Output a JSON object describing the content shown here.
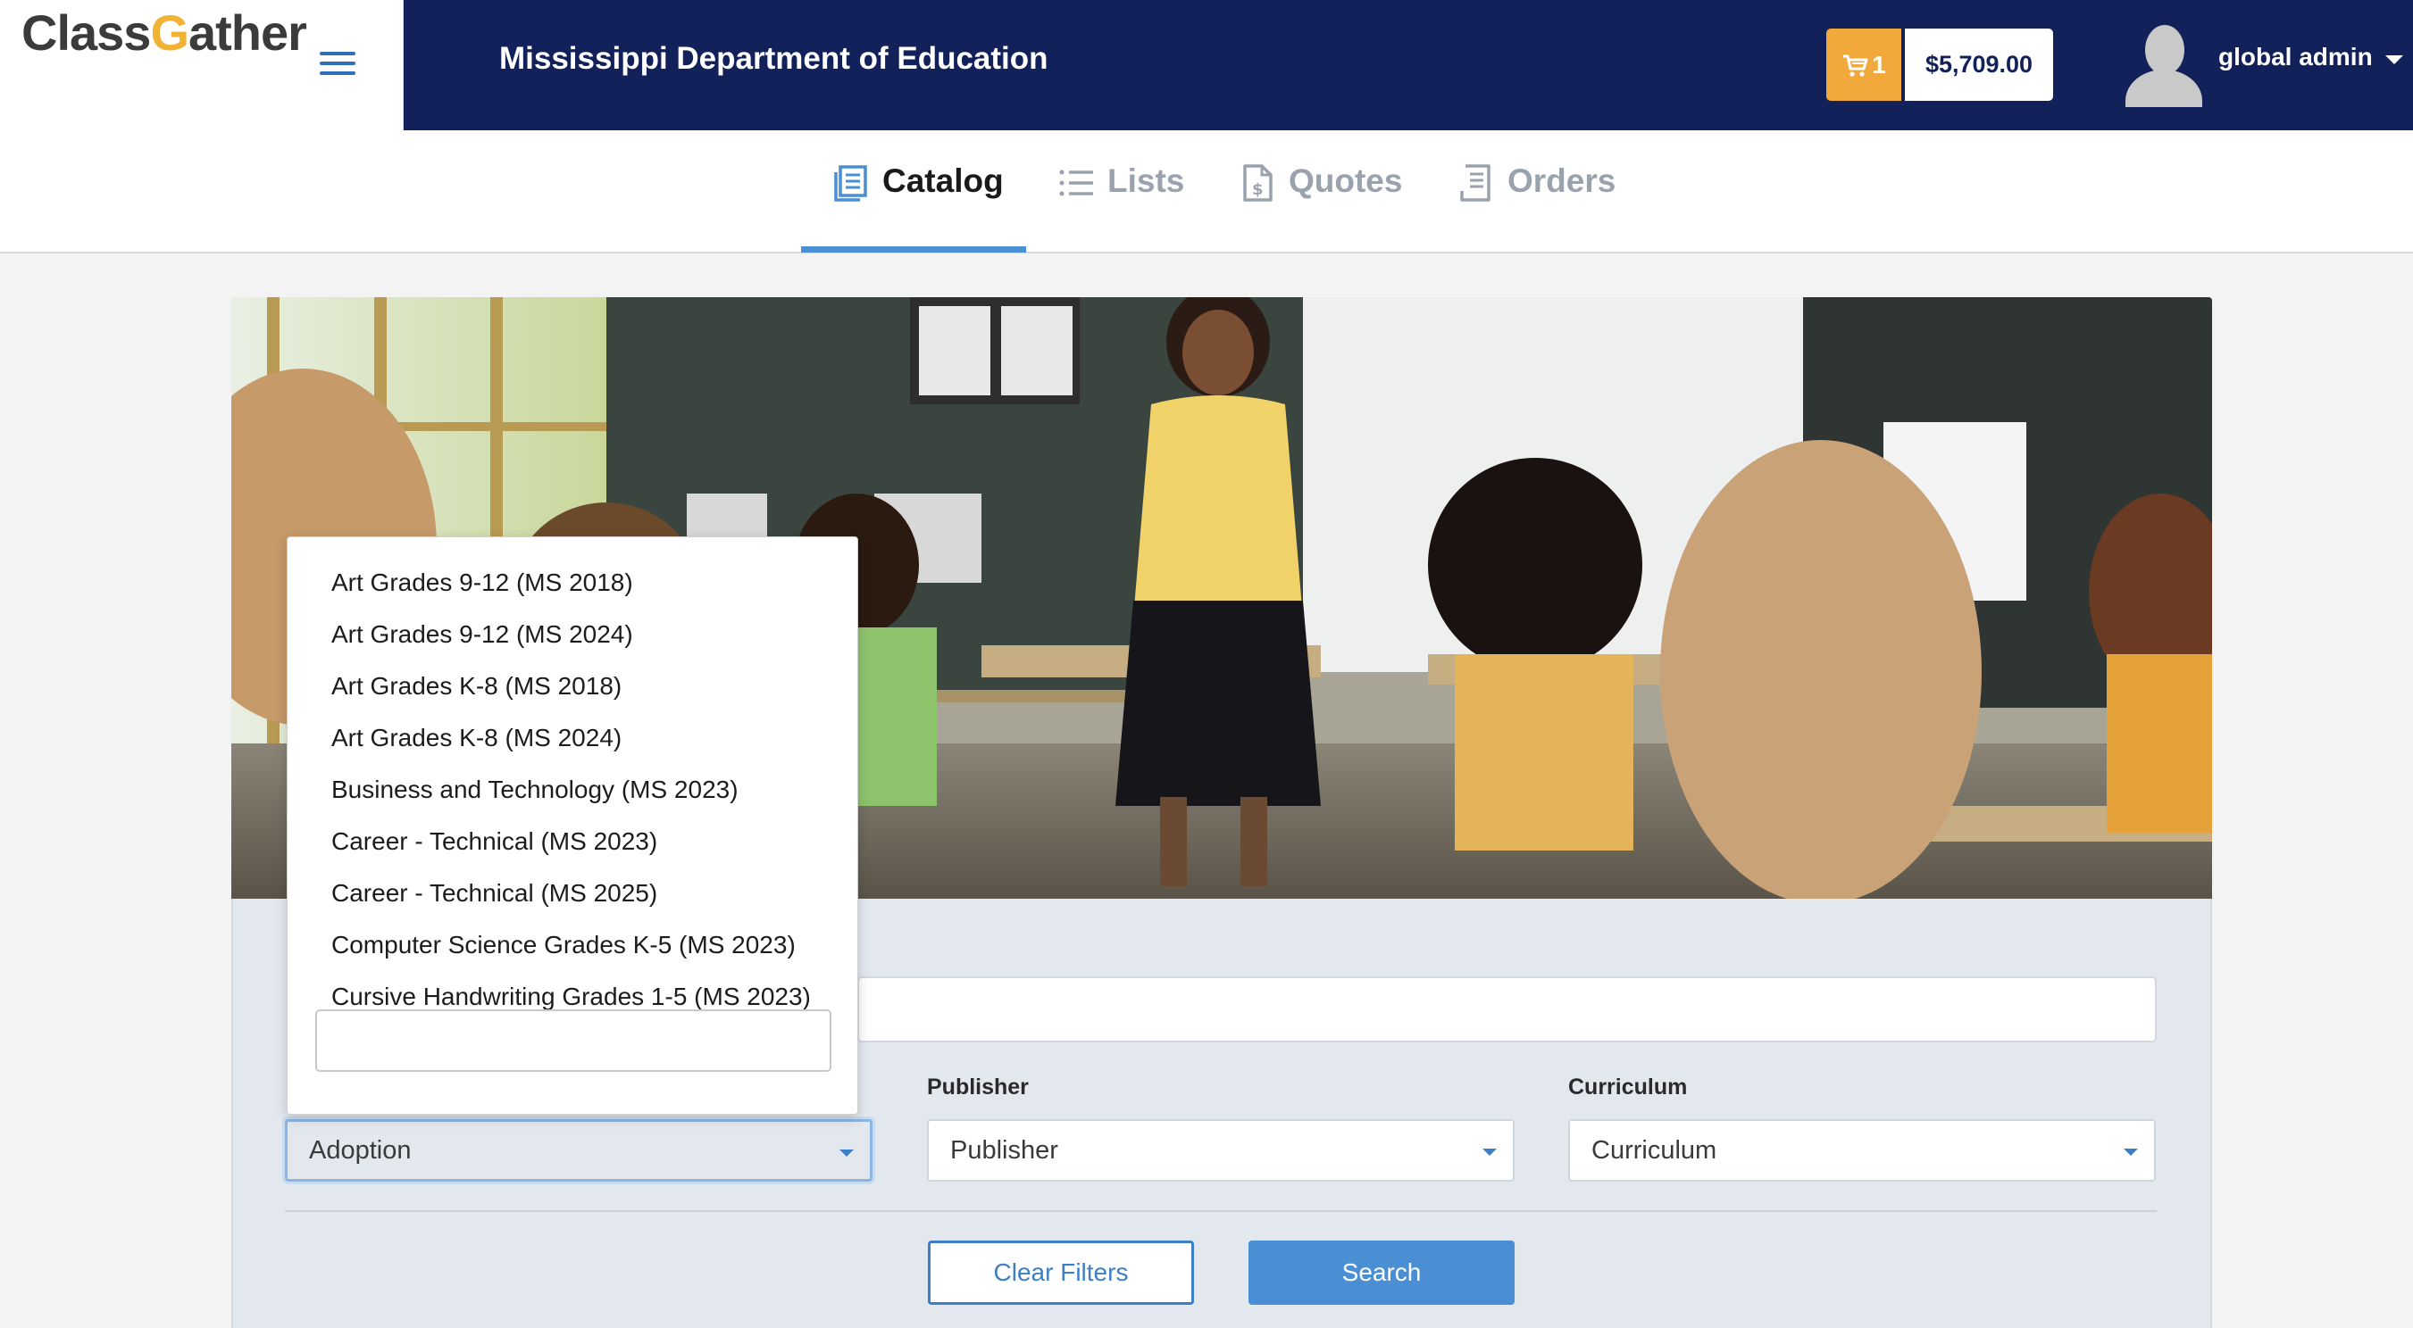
{
  "brand": {
    "logo_text_left": "Class",
    "logo_text_right": "ather",
    "logo_letter": "G",
    "org_title": "Mississippi Department of Education",
    "colors": {
      "navy": "#13215a",
      "accent": "#4a8ed4",
      "cart": "#f2a93b",
      "logo_gold": "#f2b233"
    }
  },
  "header": {
    "menu_icon": "hamburger-menu-icon",
    "cart_icon": "shopping-cart-icon",
    "cart_count": "1",
    "cart_total": "$5,709.00",
    "user_name": "global admin",
    "user_menu_icon": "chevron-down-icon"
  },
  "tabs": [
    {
      "label": "Catalog",
      "icon": "catalog-icon",
      "active": true
    },
    {
      "label": "Lists",
      "icon": "list-icon",
      "active": false
    },
    {
      "label": "Quotes",
      "icon": "quote-document-icon",
      "active": false
    },
    {
      "label": "Orders",
      "icon": "receipt-icon",
      "active": false
    }
  ],
  "filters": {
    "adoption": {
      "value": "Adoption",
      "open": true
    },
    "publisher": {
      "label": "Publisher",
      "value": "Publisher"
    },
    "curriculum": {
      "label": "Curriculum",
      "value": "Curriculum"
    },
    "keyword_value": "",
    "dropdown_search_value": "",
    "clear_label": "Clear Filters",
    "search_label": "Search"
  },
  "adoption_options": [
    "Art Grades 9-12 (MS 2018)",
    "Art Grades 9-12 (MS 2024)",
    "Art Grades K-8 (MS 2018)",
    "Art Grades K-8 (MS 2024)",
    "Business and Technology (MS 2023)",
    "Career - Technical (MS 2023)",
    "Career - Technical (MS 2025)",
    "Computer Science Grades K-5 (MS 2023)",
    "Cursive Handwriting Grades 1-5 (MS 2023)"
  ]
}
